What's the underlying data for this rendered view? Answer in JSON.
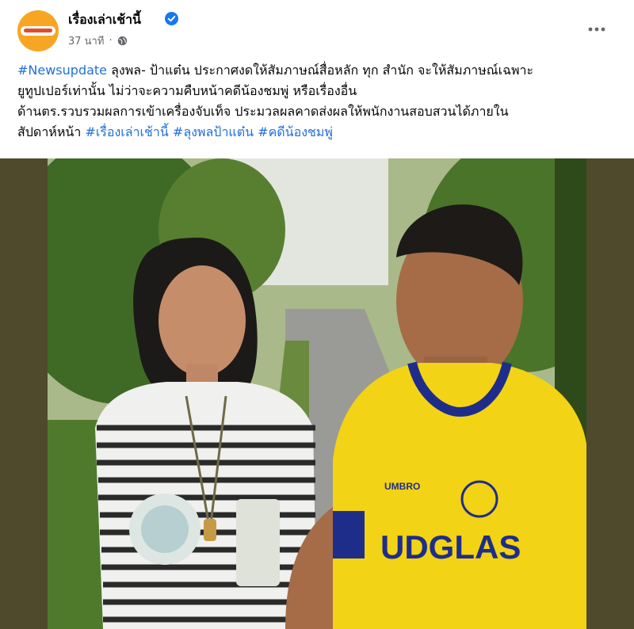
{
  "header": {
    "page_name": "เรื่องเล่าเช้านี้",
    "time": "37 นาที",
    "separator": "·",
    "more_label": "•••"
  },
  "caption": {
    "line1": [
      "#Newsupdate",
      " ลุงพล- ป้าแต๋น ประกาศงดให้สัมภาษณ์สื่อหลัก ทุก สำนัก จะให้สัมภาษณ์เฉพาะ"
    ],
    "line2": "ยูทูปเปอร์เท่านั้น ไม่ว่าจะความคืบหน้าคดีน้องชมพู่ หรือเรื่องอื่น",
    "line3": "ด้านตร.รวบรวมผลการเข้าเครื่องจับเท็จ ประมวลผลคาดส่งผลให้พนักงานสอบสวนได้ภายใน",
    "line4": [
      "สัปดาห์หน้า ",
      "#เรื่องเล่าเช้านี้",
      " ",
      "#ลุงพลป้าแต๋น",
      " ",
      "#คดีน้องชมพู่"
    ]
  },
  "photo": {
    "shirt_text": "UDGLAS",
    "shirt_brand": "UMBRO"
  },
  "colors": {
    "link": "#216fdb",
    "verified": "#1877f2",
    "avatar": "#f6a623",
    "photo_border": "#4f4a2c"
  },
  "icons": {
    "verified": "verified-badge-icon",
    "globe": "globe-icon",
    "more": "more-options-icon"
  }
}
